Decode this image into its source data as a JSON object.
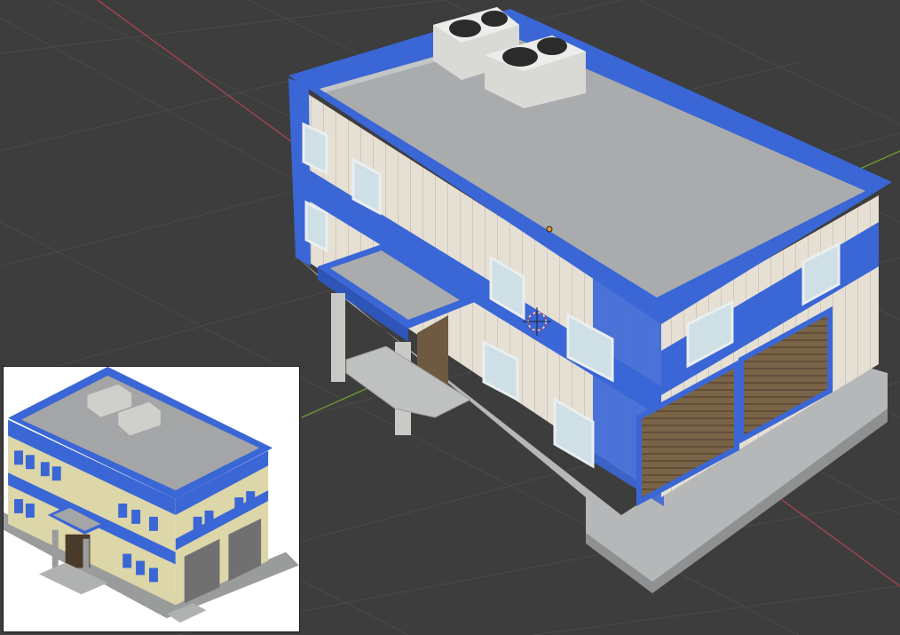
{
  "app": "3d-viewport",
  "viewport": {
    "background": "#3d3d3d",
    "grid_color": "#474747",
    "x_axis_color": "#b04a55",
    "y_axis_color": "#7aa83a"
  },
  "model": {
    "wall_accent": "#3a66d6",
    "roof_color": "#a9abad",
    "siding_color": "#e4ddd0",
    "window_color": "#cfdfe6",
    "door_color": "#7a6448",
    "base_color": "#b5b7b8"
  },
  "overlays": {
    "origin_marker": "origin-point",
    "cursor": "3d-cursor"
  },
  "reference_image": {
    "background": "#ffffff",
    "siding_color": "#dcd6a8"
  }
}
